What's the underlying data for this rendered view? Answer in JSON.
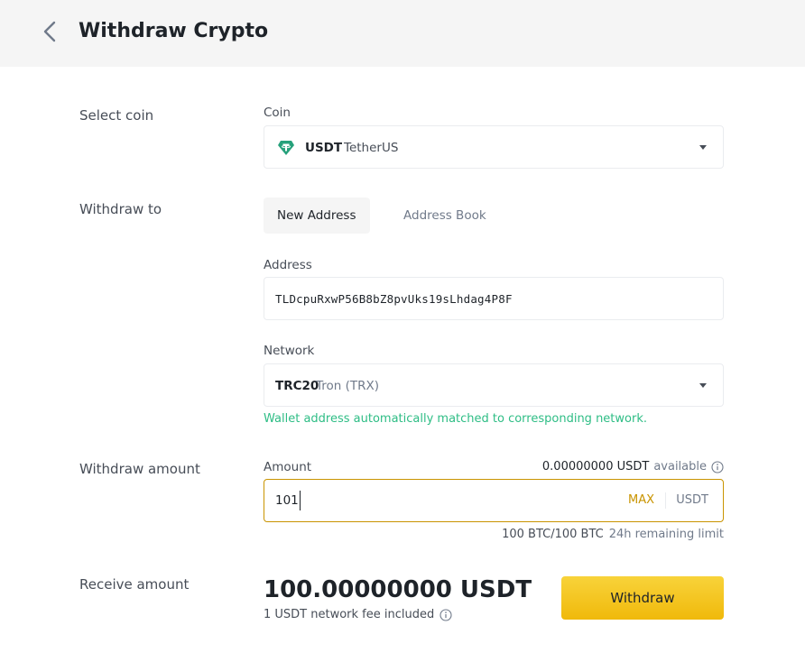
{
  "header": {
    "title": "Withdraw Crypto",
    "back_icon": "chevron-left-icon"
  },
  "select_coin": {
    "row_label": "Select coin",
    "field_label": "Coin",
    "symbol": "USDT",
    "name": "TetherUS",
    "icon": "tether-icon",
    "icon_color": "#26a17b"
  },
  "withdraw_to": {
    "row_label": "Withdraw to",
    "tabs": [
      {
        "label": "New Address",
        "active": true
      },
      {
        "label": "Address Book",
        "active": false
      }
    ],
    "address_label": "Address",
    "address_value": "TLDcpuRxwP56B8bZ8pvUks19sLhdag4P8F",
    "network_label": "Network",
    "network_code": "TRC20",
    "network_name": "Tron (TRX)",
    "match_note": "Wallet address automatically matched to corresponding network."
  },
  "withdraw_amount": {
    "row_label": "Withdraw amount",
    "field_label": "Amount",
    "available_amount": "0.00000000 USDT",
    "available_word": "available",
    "value": "101",
    "max_label": "MAX",
    "unit": "USDT",
    "limit": "100 BTC/100 BTC",
    "limit_note": "24h remaining limit"
  },
  "receive": {
    "row_label": "Receive amount",
    "amount": "100.00000000 USDT",
    "fee_note": "1 USDT network fee included",
    "button_label": "Withdraw"
  },
  "colors": {
    "accent": "#f0b90b",
    "success": "#2ebd85",
    "focus_border": "#c99400"
  }
}
